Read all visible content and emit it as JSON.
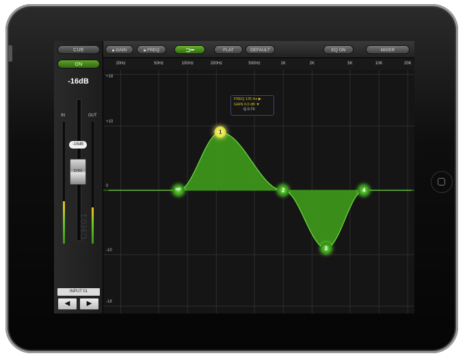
{
  "channel": {
    "cue_label": "CUE",
    "on_label": "ON",
    "level_readout": "-16dB",
    "in_label": "IN",
    "out_label": "OUT",
    "fader_value": "-16dB",
    "fader_cap_label": "CH01",
    "channel_name": "CH01",
    "input_label": "INPUT 01",
    "prev_icon": "arrow-left-icon",
    "next_icon": "arrow-right-icon",
    "in_meter_level": 0.35,
    "out_meter_level": 0.3
  },
  "toolbar": {
    "gain_label": "GAIN",
    "freq_label": "FREQ",
    "bypass_icon": "bypass-icon",
    "flat_label": "FLAT",
    "default_label": "DEFAULT",
    "eq_on_label": "EQ ON",
    "mixer_label": "MIXER"
  },
  "freq_axis": [
    "20Hz",
    "50Hz",
    "100Hz",
    "200Hz",
    "500Hz",
    "1K",
    "2K",
    "5K",
    "10K",
    "20K"
  ],
  "gain_axis": [
    "+18",
    "+10",
    "0",
    "-10",
    "-18"
  ],
  "info_box": {
    "freq": "FREQ 125 Hz",
    "gain": "GAIN 0.0 dB",
    "q": "Q 0.70"
  },
  "nodes": [
    {
      "label": "HP",
      "freq_hz": 80,
      "gain_db": 0
    },
    {
      "label": "1",
      "freq_hz": 220,
      "gain_db": 9
    },
    {
      "label": "2",
      "freq_hz": 1000,
      "gain_db": 0
    },
    {
      "label": "3",
      "freq_hz": 2800,
      "gain_db": -9
    },
    {
      "label": "4",
      "freq_hz": 7000,
      "gain_db": 0
    }
  ],
  "colors": {
    "curve_fill": "#3f9a1a",
    "curve_line": "#6fe040",
    "selected_node": "#ffff80"
  }
}
